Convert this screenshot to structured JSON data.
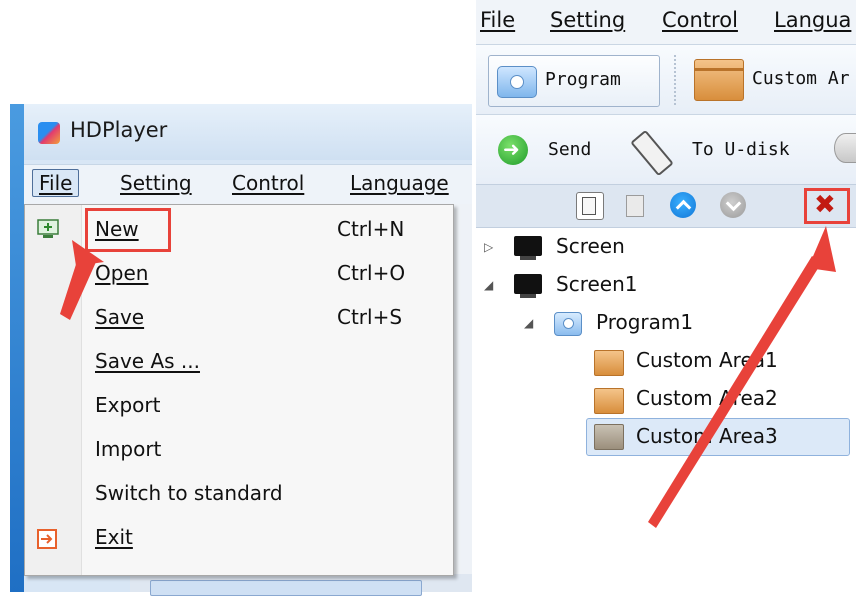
{
  "left_window": {
    "app_title": "HDPlayer",
    "menu": [
      "File",
      "Setting",
      "Control",
      "Language"
    ],
    "file_menu_items": [
      {
        "label": "New",
        "shortcut": "Ctrl+N"
      },
      {
        "label": "Open",
        "shortcut": "Ctrl+O"
      },
      {
        "label": "Save",
        "shortcut": "Ctrl+S"
      },
      {
        "label": "Save As ...",
        "shortcut": ""
      },
      {
        "label": "Export",
        "shortcut": ""
      },
      {
        "label": "Import",
        "shortcut": ""
      },
      {
        "label": "Switch to standard",
        "shortcut": ""
      },
      {
        "label": "Exit",
        "shortcut": ""
      }
    ]
  },
  "right_window": {
    "menu": [
      "File",
      "Setting",
      "Control",
      "Langua"
    ],
    "toolbar1": {
      "program_label": "Program",
      "custom_area_label": "Custom Ar"
    },
    "toolbar2": {
      "send_label": "Send",
      "usb_label": "To U-disk"
    },
    "toolbar3_icons": [
      "copy-icon",
      "paste-icon",
      "move-up-icon",
      "move-down-icon",
      "delete-icon"
    ],
    "tree": [
      {
        "label": "Screen",
        "level": 0,
        "expander": "▷",
        "icon": "monitor-icon"
      },
      {
        "label": "Screen1",
        "level": 0,
        "expander": "◢",
        "icon": "monitor-icon"
      },
      {
        "label": "Program1",
        "level": 1,
        "expander": "◢",
        "icon": "program-icon"
      },
      {
        "label": "Custom Area1",
        "level": 2,
        "expander": "",
        "icon": "area-icon"
      },
      {
        "label": "Custom Area2",
        "level": 2,
        "expander": "",
        "icon": "area-icon"
      },
      {
        "label": "Custom Area3",
        "level": 2,
        "expander": "",
        "icon": "area-icon",
        "selected": true
      }
    ]
  },
  "annotations": {
    "highlight_color": "#e8423a"
  }
}
